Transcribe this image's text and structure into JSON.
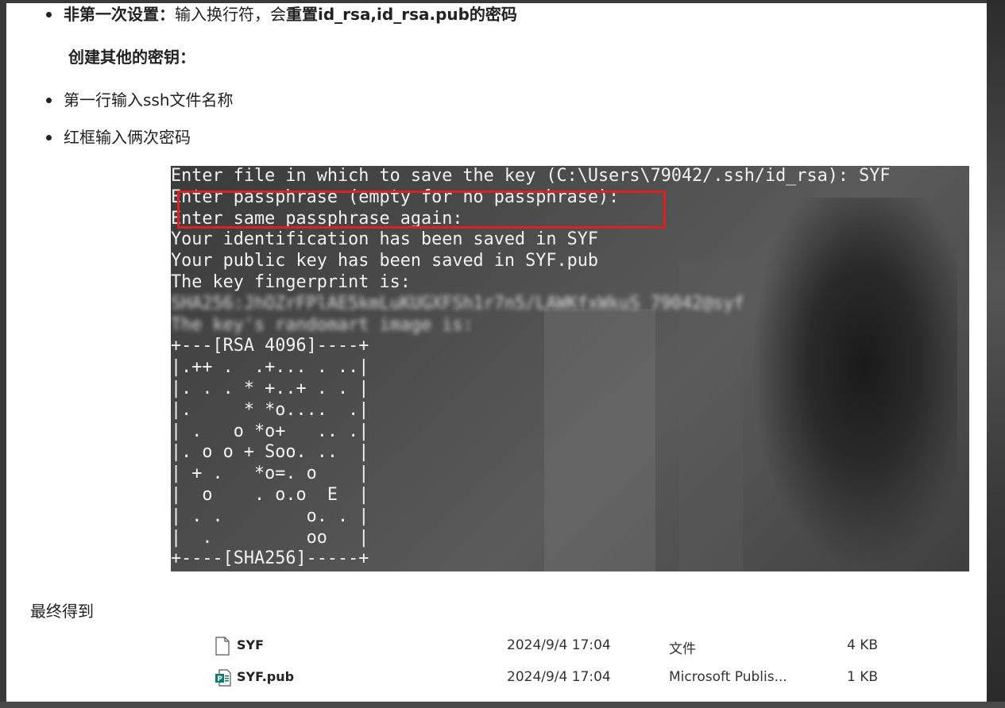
{
  "bullets": [
    {
      "bold1": "非第一次设置：",
      "text": "输入换行符，会",
      "bold2": "重置id_rsa,id_rsa.pub的密码"
    },
    {
      "heading": "创建其他的密钥："
    },
    {
      "text": "第一行输入ssh文件名称"
    },
    {
      "text": "红框输入俩次密码"
    }
  ],
  "terminal": {
    "lines": [
      "Enter file in which to save the key (C:\\Users\\79042/.ssh/id_rsa): SYF",
      "Enter passphrase (empty for no passphrase):",
      "Enter same passphrase again:",
      "Your identification has been saved in SYF",
      "Your public key has been saved in SYF.pub",
      "The key fingerprint is:",
      "SHA256:JhOZrFPlAE5kmLuKUGXFSh1r7n5/LAWKfxWkuS 79042@syf",
      "The key's randomart image is:",
      "+---[RSA 4096]----+",
      "|.++ .  .+... . ..|",
      "|. . . * +..+ . . |",
      "|.     * *o....  .|",
      "| .   o *o+   .. .|",
      "|. o o + Soo. ..  |",
      "| + .   *o=. o    |",
      "|  o    . o.o  E  |",
      "| . .        o. . |",
      "|  .         oo   |",
      "+----[SHA256]-----+"
    ]
  },
  "final_label": "最终得到",
  "files": [
    {
      "name": "SYF",
      "date": "2024/9/4 17:04",
      "type": "文件",
      "size": "4 KB",
      "icon": "file-icon"
    },
    {
      "name": "SYF.pub",
      "date": "2024/9/4 17:04",
      "type": "Microsoft Publis...",
      "size": "1 KB",
      "icon": "publisher-file-icon"
    }
  ],
  "colors": {
    "highlight_box": "#e02020",
    "terminal_text": "#f2f2f2"
  }
}
